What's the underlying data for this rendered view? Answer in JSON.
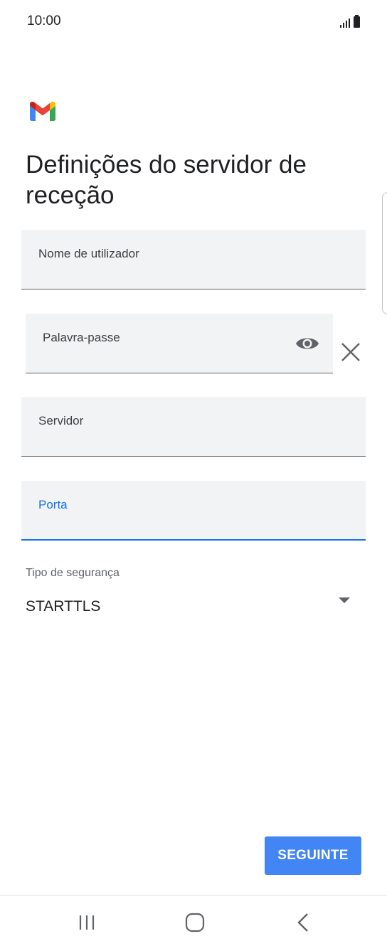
{
  "status_bar": {
    "time": "10:00",
    "icons": [
      "signal-icon",
      "battery-icon"
    ]
  },
  "app": {
    "logo": "gmail-logo",
    "title": "Definições do servidor de receção"
  },
  "form": {
    "username": {
      "label": "Nome de utilizador",
      "value": ""
    },
    "password": {
      "label": "Palavra-passe",
      "value": "",
      "icon": "eye-icon"
    },
    "server": {
      "label": "Servidor",
      "value": ""
    },
    "port": {
      "label": "Porta",
      "value": "",
      "focused": true
    },
    "security": {
      "label": "Tipo de segurança",
      "value": "STARTTLS"
    }
  },
  "actions": {
    "next_label": "SEGUINTE"
  },
  "nav_bar": {
    "icons": [
      "recents-icon",
      "home-icon",
      "back-icon"
    ]
  },
  "colors": {
    "accent": "#1a73e8",
    "button": "#4285f4",
    "field_bg": "#f1f3f4",
    "gmail_red": "#ea4335",
    "gmail_blue": "#4285f4",
    "gmail_green": "#34a853",
    "gmail_yellow": "#fbbc04"
  }
}
